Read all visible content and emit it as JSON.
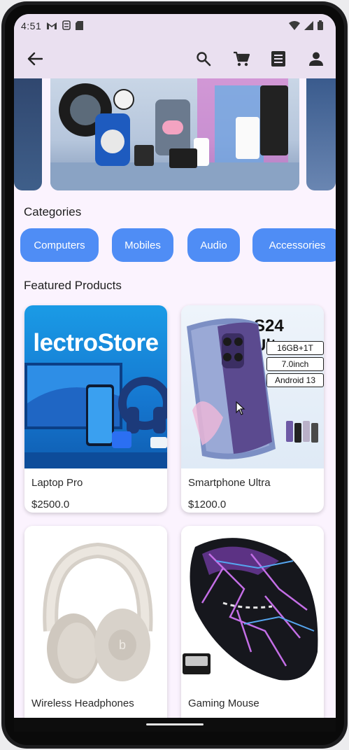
{
  "status_bar": {
    "time": "4:51",
    "icons_left": [
      "gmail-icon",
      "sync-icon",
      "sd-card-icon"
    ],
    "icons_right": [
      "wifi-icon",
      "cell-signal-icon",
      "battery-icon"
    ]
  },
  "app_bar": {
    "icons": [
      "back-arrow-icon",
      "search-icon",
      "cart-icon",
      "orders-icon",
      "account-icon"
    ]
  },
  "categories": {
    "title": "Categories",
    "items": [
      "Computers",
      "Mobiles",
      "Audio",
      "Accessories"
    ]
  },
  "featured": {
    "title": "Featured Products",
    "products": [
      {
        "name": "Laptop Pro",
        "price": "$2500.0",
        "image_text": "lectroStore"
      },
      {
        "name": "Smartphone Ultra",
        "price": "$1200.0",
        "image_text": "S24 Ultra",
        "specs": [
          "16GB+1T",
          "7.0inch",
          "Android 13"
        ]
      },
      {
        "name": "Wireless Headphones",
        "price": ""
      },
      {
        "name": "Gaming Mouse",
        "price": ""
      }
    ]
  },
  "colors": {
    "chip": "#4f8df5",
    "app_bar": "#eae0f0",
    "background": "#fbf3fe"
  }
}
